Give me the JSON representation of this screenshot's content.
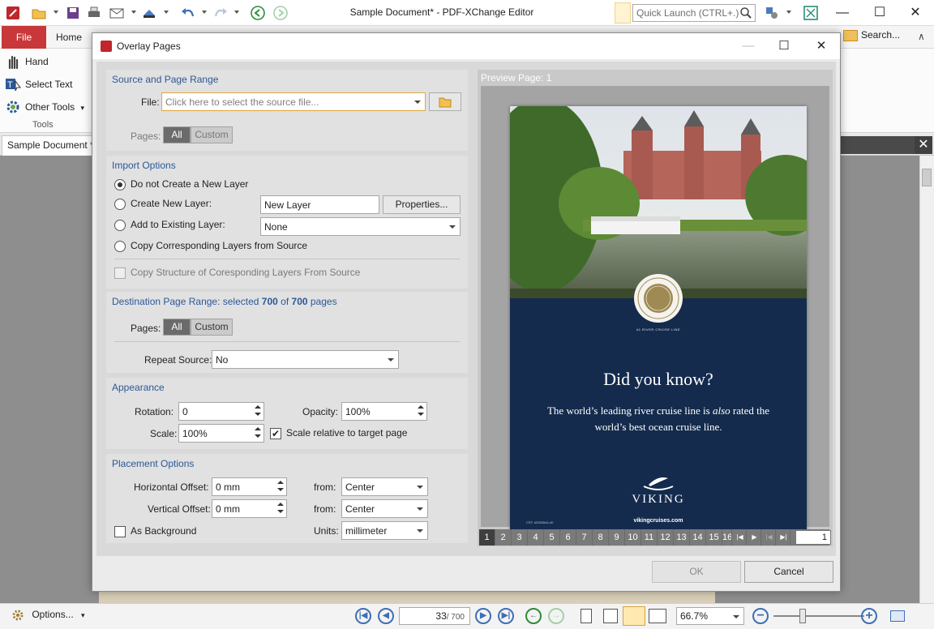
{
  "app": {
    "title": "Sample Document* - PDF-XChange Editor",
    "quick_launch_placeholder": "Quick Launch (CTRL+.)",
    "window_controls": {
      "minimize": "—",
      "maximize": "☐",
      "close": "✕"
    }
  },
  "ribbon": {
    "tabs": [
      "File",
      "Home"
    ],
    "tools": [
      {
        "label": "Hand",
        "icon": "hand-icon"
      },
      {
        "label": "Select Text",
        "icon": "select-text-icon"
      },
      {
        "label": "Other Tools",
        "icon": "other-tools-icon"
      }
    ],
    "group_label": "Tools",
    "search_label": "Search...",
    "collapse_glyph": "∧"
  },
  "doc_tab": {
    "label": "Sample Document *",
    "close_glyph": "✕"
  },
  "statusbar": {
    "options_label": "Options...",
    "current_page": "33",
    "total_pages": "/ 700",
    "zoom": "66.7%"
  },
  "dialog": {
    "title": "Overlay Pages",
    "source": {
      "title": "Source and Page Range",
      "file_label": "File:",
      "file_placeholder": "Click here to select the source file...",
      "pages_label": "Pages:",
      "pages_options": [
        "All",
        "Custom"
      ],
      "pages_selected": "All"
    },
    "import": {
      "title": "Import Options",
      "options": [
        "Do not Create a New Layer",
        "Create New Layer:",
        "Add to Existing Layer:",
        "Copy Corresponding Layers from Source"
      ],
      "selected_index": 0,
      "new_layer_value": "New Layer",
      "properties_label": "Properties...",
      "existing_layer_value": "None",
      "copy_structure_label": "Copy Structure of Coresponding Layers From Source"
    },
    "destination": {
      "title_prefix": "Destination Page Range: selected ",
      "selected": "700",
      "of_text": " of ",
      "total": "700",
      "suffix": " pages",
      "pages_label": "Pages:",
      "pages_options": [
        "All",
        "Custom"
      ],
      "repeat_label": "Repeat Source:",
      "repeat_value": "No"
    },
    "appearance": {
      "title": "Appearance",
      "rotation_label": "Rotation:",
      "rotation_value": "0",
      "opacity_label": "Opacity:",
      "opacity_value": "100%",
      "scale_label": "Scale:",
      "scale_value": "100%",
      "scale_relative_label": "Scale relative to target page",
      "scale_relative_checked": true
    },
    "placement": {
      "title": "Placement Options",
      "h_offset_label": "Horizontal Offset:",
      "h_offset_value": "0 mm",
      "v_offset_label": "Vertical Offset:",
      "v_offset_value": "0 mm",
      "from_label": "from:",
      "h_from_value": "Center",
      "v_from_value": "Center",
      "units_label": "Units:",
      "units_value": "millimeter",
      "as_background_label": "As Background",
      "as_background_checked": false
    },
    "preview": {
      "title": "Preview Page: 1",
      "heading": "Did you know?",
      "body_1": "The world’s leading river cruise line is ",
      "body_em": "also",
      "body_2": " rated the world’s best ocean cruise line.",
      "badge_caption": "#1 RIVER CRUISE LINE",
      "brand": "VIKING",
      "url": "vikingcruises.com",
      "code": "CST: #2052644-40",
      "pages": [
        "1",
        "2",
        "3",
        "4",
        "5",
        "6",
        "7",
        "8",
        "9",
        "10",
        "11",
        "12",
        "13",
        "14",
        "15",
        "16"
      ],
      "current_page": "1",
      "page_input": "1"
    },
    "ok_label": "OK",
    "cancel_label": "Cancel"
  },
  "colors": {
    "accent_red": "#c8383a",
    "section_title_blue": "#2b5896",
    "preview_navy": "#142b4d"
  }
}
